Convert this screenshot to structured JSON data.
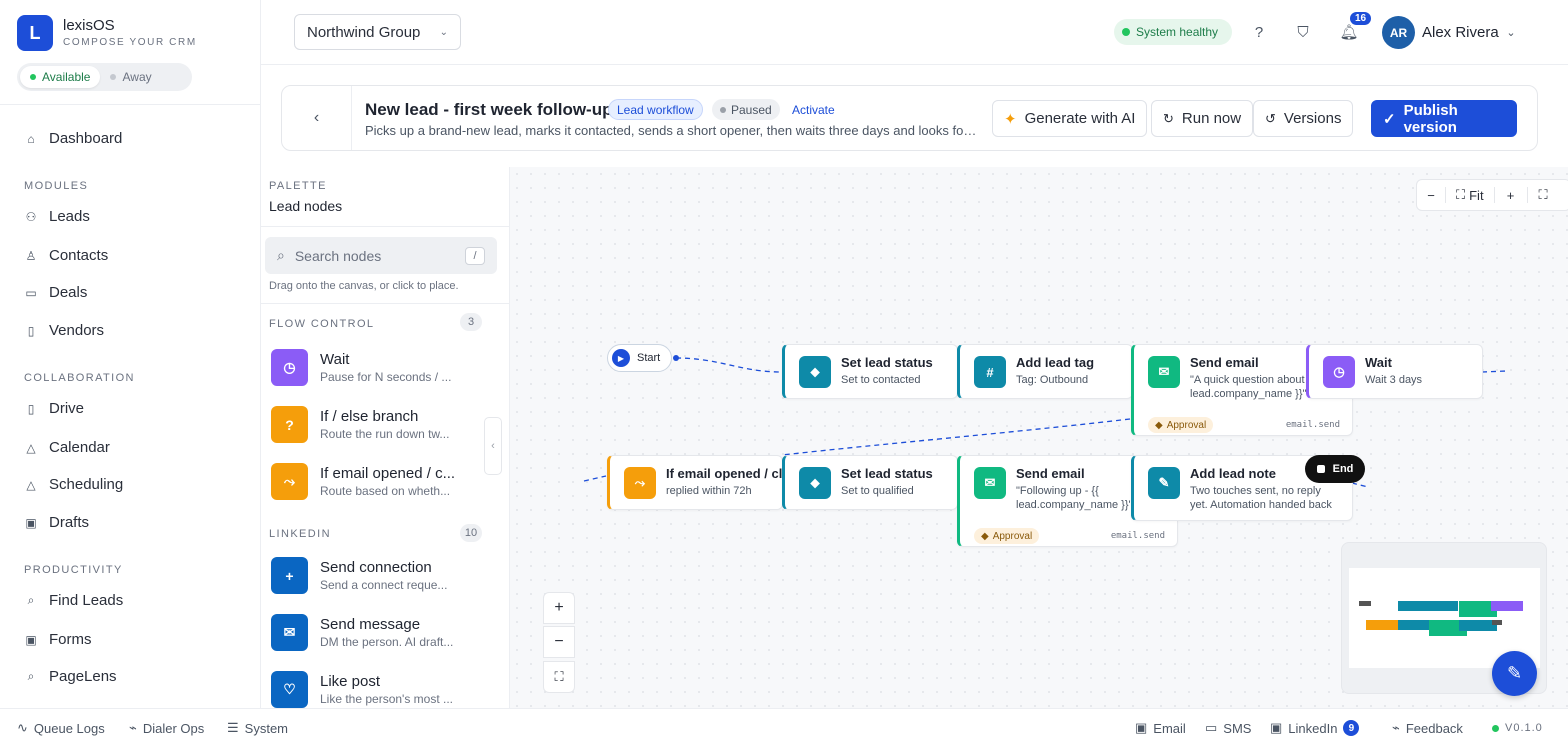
{
  "brand": {
    "name": "lexisOS",
    "tagline": "COMPOSE YOUR CRM",
    "logo_letter": "L"
  },
  "presence": {
    "available": "Available",
    "away": "Away"
  },
  "nav": {
    "dashboard": "Dashboard",
    "modules_label": "MODULES",
    "modules": [
      "Leads",
      "Contacts",
      "Deals",
      "Vendors"
    ],
    "collab_label": "COLLABORATION",
    "collab": [
      "Drive",
      "Calendar",
      "Scheduling",
      "Drafts"
    ],
    "productivity_label": "PRODUCTIVITY",
    "productivity": [
      "Find Leads",
      "Forms",
      "PageLens"
    ]
  },
  "topbar": {
    "workspace": "Northwind Group",
    "status": "System healthy",
    "notifications": "16",
    "user_initials": "AR",
    "user_name": "Alex Rivera"
  },
  "workflow": {
    "title": "New lead - first week follow-up",
    "type_chip": "Lead workflow",
    "state_chip": "Paused",
    "activate": "Activate",
    "description": "Picks up a brand-new lead, marks it contacted, sends a short opener, then waits three days and looks for a...",
    "buttons": {
      "generate": "Generate with AI",
      "run": "Run now",
      "versions": "Versions",
      "publish": "Publish version"
    }
  },
  "palette": {
    "label": "PALETTE",
    "title": "Lead nodes",
    "search_placeholder": "Search nodes",
    "search_key": "/",
    "hint": "Drag onto the canvas, or click to place.",
    "flow_label": "FLOW CONTROL",
    "flow_count": "3",
    "flow": [
      {
        "title": "Wait",
        "sub": "Pause for N seconds / ...",
        "icon": "clock-icon",
        "color": "#8b5cf6"
      },
      {
        "title": "If / else branch",
        "sub": "Route the run down tw...",
        "icon": "question-icon",
        "color": "#f59e0b"
      },
      {
        "title": "If email opened / c...",
        "sub": "Route based on wheth...",
        "icon": "branch-icon",
        "color": "#f59e0b"
      }
    ],
    "linkedin_label": "LINKEDIN",
    "linkedin_count": "10",
    "linkedin": [
      {
        "title": "Send connection",
        "sub": "Send a connect reque...",
        "icon": "plus-icon",
        "color": "#0a66c2"
      },
      {
        "title": "Send message",
        "sub": "DM the person. AI draft...",
        "icon": "mail-icon",
        "color": "#0a66c2"
      },
      {
        "title": "Like post",
        "sub": "Like the person's most ...",
        "icon": "heart-icon",
        "color": "#0a66c2"
      }
    ]
  },
  "canvas": {
    "fit": "Fit",
    "start": "Start",
    "end": "End",
    "nodes": [
      {
        "id": "n1",
        "title": "Set lead status",
        "sub": "Set to contacted",
        "color": "#0e8aa8"
      },
      {
        "id": "n2",
        "title": "Add lead tag",
        "sub": "Tag: Outbound",
        "color": "#0e8aa8"
      },
      {
        "id": "n3",
        "title": "Send email",
        "sub": "\"A quick question about {{ lead.company_name }}\"",
        "color": "#10b981",
        "approval": "Approval",
        "code": "email.send"
      },
      {
        "id": "n4",
        "title": "Wait",
        "sub": "Wait 3 days",
        "color": "#8b5cf6"
      },
      {
        "id": "n5",
        "title": "If email opened / clicked",
        "sub": "replied within 72h",
        "color": "#f59e0b"
      },
      {
        "id": "n6",
        "title": "Set lead status",
        "sub": "Set to qualified",
        "color": "#0e8aa8"
      },
      {
        "id": "n7",
        "title": "Send email",
        "sub": "\"Following up - {{ lead.company_name }}\"",
        "color": "#10b981",
        "approval": "Approval",
        "code": "email.send"
      },
      {
        "id": "n8",
        "title": "Add lead note",
        "sub": "Two touches sent, no reply yet. Automation handed back to a...",
        "color": "#0e8aa8"
      }
    ]
  },
  "footer": {
    "queue": "Queue Logs",
    "dialer": "Dialer Ops",
    "system": "System",
    "email": "Email",
    "sms": "SMS",
    "linkedin": "LinkedIn",
    "linkedin_count": "9",
    "feedback": "Feedback",
    "version": "V0.1.0"
  }
}
